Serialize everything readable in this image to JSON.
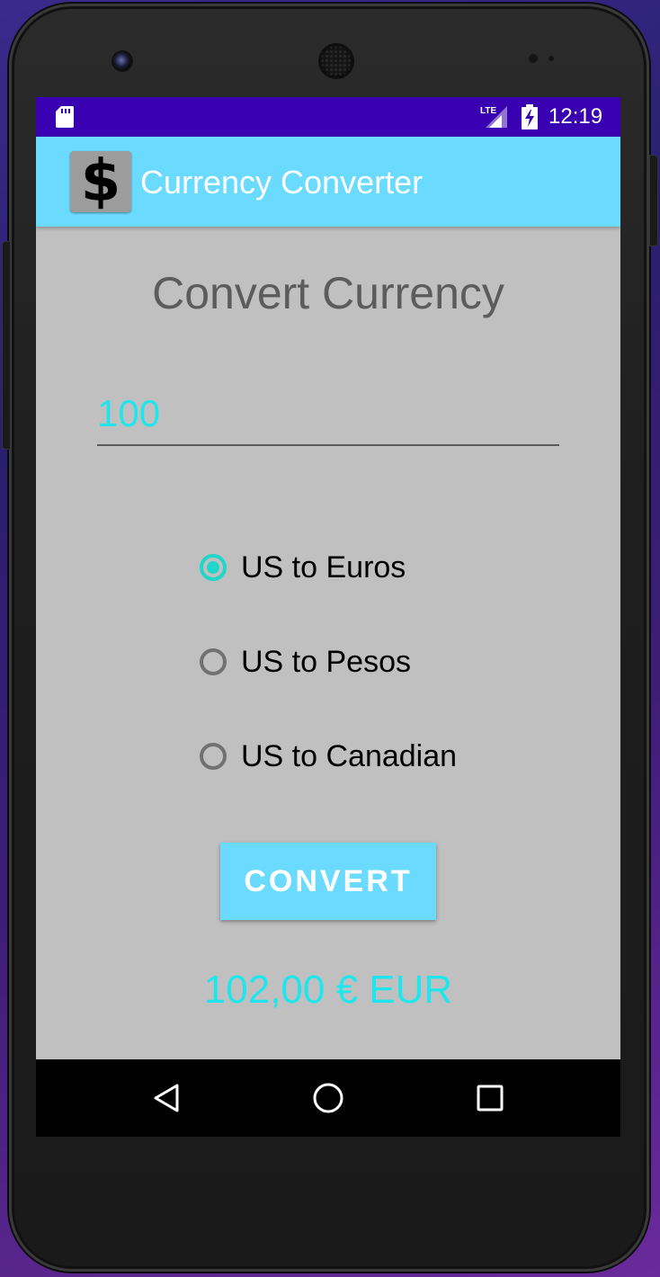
{
  "status_bar": {
    "time": "12:19",
    "network": "LTE",
    "icons": [
      "sd-card-icon",
      "lte-signal-icon",
      "battery-charging-icon"
    ]
  },
  "app_bar": {
    "logo_glyph": "$",
    "title": "Currency Converter",
    "color": "#6adbff"
  },
  "main": {
    "heading": "Convert Currency",
    "amount_value": "100",
    "conversion_options": [
      {
        "label": "US to Euros",
        "checked": true
      },
      {
        "label": "US to Pesos",
        "checked": false
      },
      {
        "label": "US to Canadian",
        "checked": false
      }
    ],
    "convert_label": "CONVERT",
    "result": "102,00 € EUR"
  },
  "nav_bar": {
    "icons": [
      "back-icon",
      "home-icon",
      "recents-icon"
    ]
  },
  "colors": {
    "status_bar": "#3800b0",
    "accent": "#1fd6c8",
    "result_text": "#1fe6ee",
    "screen_bg": "#c0c0c0"
  }
}
